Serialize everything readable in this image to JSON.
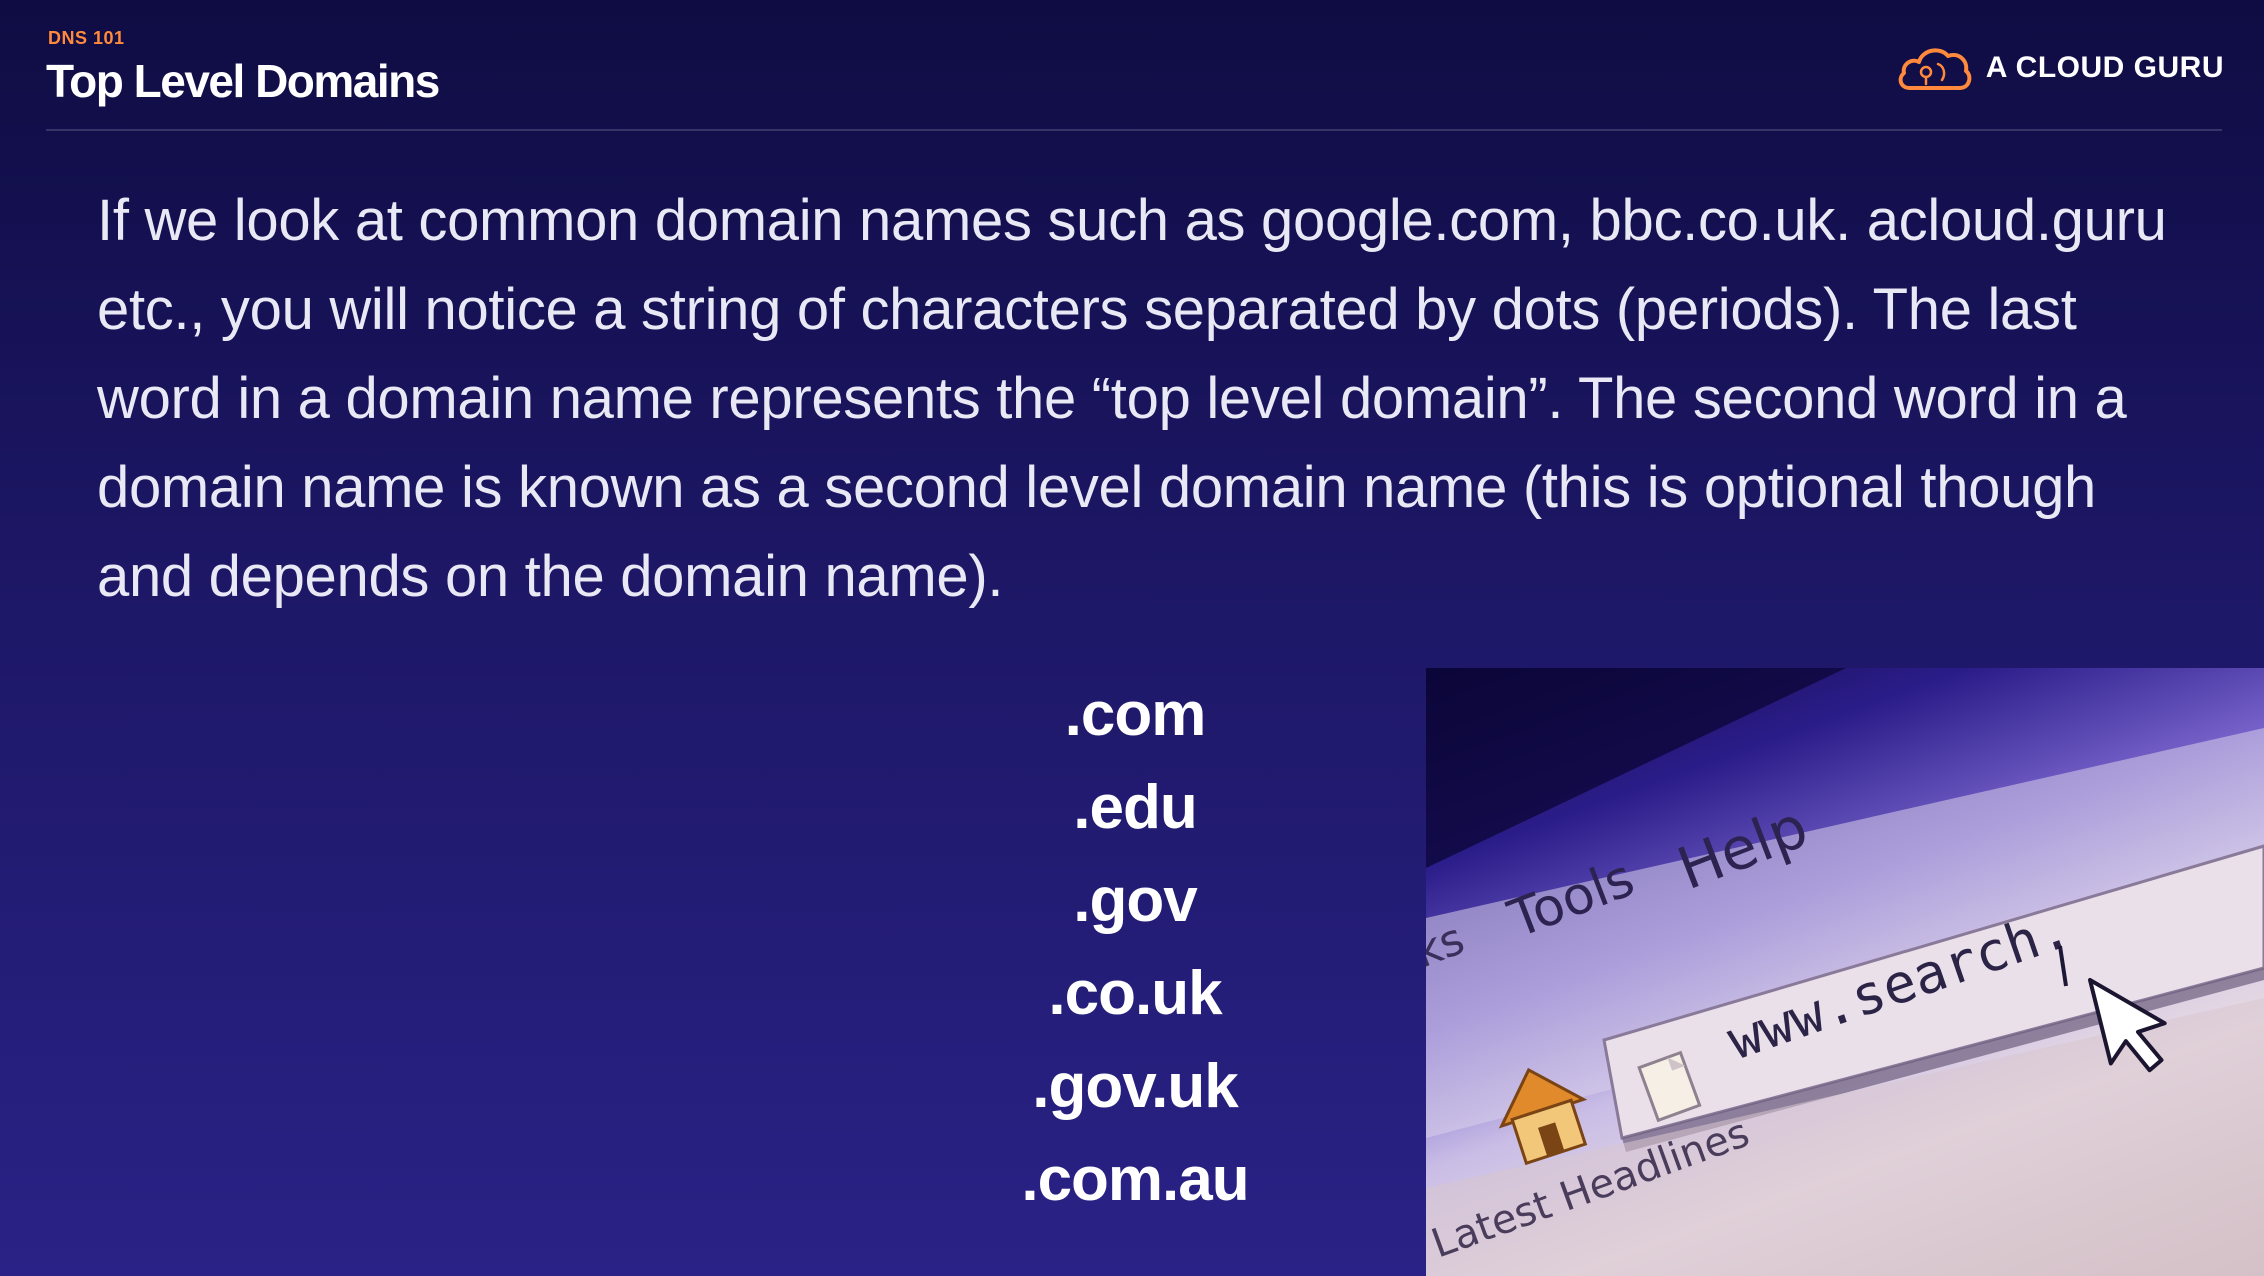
{
  "header": {
    "kicker": "DNS 101",
    "title": "Top Level Domains",
    "brand": "A CLOUD GURU",
    "brand_color": "#ff8a3d"
  },
  "body": {
    "paragraph": "If we look at common domain names such as google.com, bbc.co.uk. acloud.guru etc., you will notice a string of characters separated by dots (periods). The last word in a domain name represents the “top level domain”.  The second word in a domain name is known as a second level domain name (this is optional though and depends on the domain name)."
  },
  "tlds": [
    ".com",
    ".edu",
    ".gov",
    ".co.uk",
    ".gov.uk",
    ".com.au"
  ],
  "photo": {
    "menu_items": [
      "ks",
      "Tools",
      "Help"
    ],
    "address_text": "www.search.",
    "bottom_text": "Latest Headlines",
    "icons": [
      "home-icon",
      "page-icon",
      "mouse-cursor-icon"
    ]
  },
  "colors": {
    "background_top": "#0f0c43",
    "background_bottom": "#2a2286",
    "accent": "#ff8a3d"
  }
}
